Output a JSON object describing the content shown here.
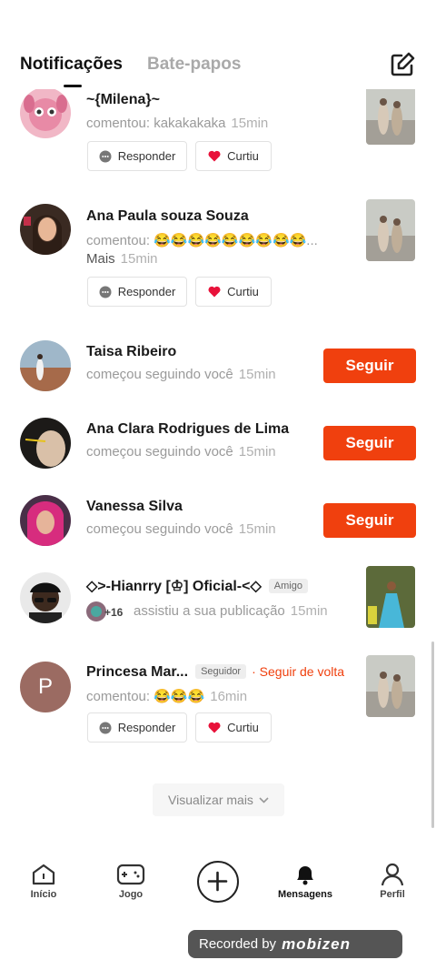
{
  "tabs": {
    "active": "Notificações",
    "inactive": "Bate-papos"
  },
  "colors": {
    "accent": "#f0400e"
  },
  "notifications": [
    {
      "name": "~{Milena}~",
      "action": "comentou: kakakakaka",
      "time": "15min",
      "reply": "Responder",
      "like": "Curtiu"
    },
    {
      "name": "Ana Paula souza Souza",
      "action": "comentou: 😂😂😂😂😂😂😂😂😂...",
      "action2": "Mais",
      "time": "15min",
      "reply": "Responder",
      "like": "Curtiu"
    },
    {
      "name": "Taisa Ribeiro",
      "action": "começou seguindo você",
      "time": "15min",
      "button": "Seguir"
    },
    {
      "name": "Ana Clara Rodrigues de Lima",
      "action": "começou seguindo você",
      "time": "15min",
      "button": "Seguir"
    },
    {
      "name": "Vanessa Silva",
      "action": "começou seguindo você",
      "time": "15min",
      "button": "Seguir"
    },
    {
      "name": "◇>-Hianrry [♔] Oficial-<◇",
      "badge": "Amigo",
      "count": "+16",
      "action": "assistiu a sua publicação",
      "time": "15min"
    },
    {
      "name": "Princesa Mar...",
      "avatar_letter": "P",
      "badge": "Seguidor",
      "followback": "· Seguir de volta",
      "action": "comentou: 😂😂😂",
      "time": "16min",
      "reply": "Responder",
      "like": "Curtiu"
    }
  ],
  "more_label": "Visualizar mais",
  "nav": {
    "home": "Início",
    "game": "Jogo",
    "messages": "Mensagens",
    "profile": "Perfil"
  },
  "recorded": {
    "text": "Recorded by",
    "brand": "mobizen"
  }
}
